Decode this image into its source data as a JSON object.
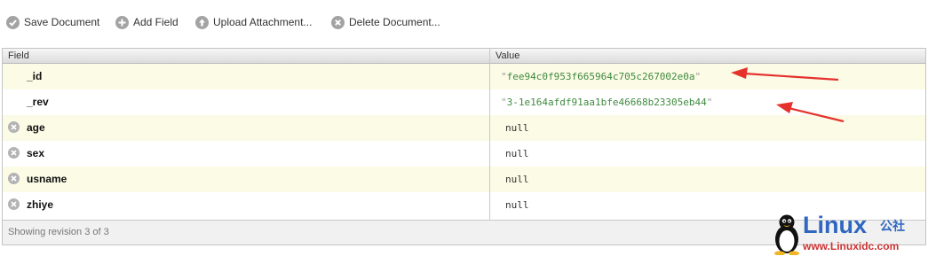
{
  "toolbar": {
    "save_label": "Save Document",
    "add_field_label": "Add Field",
    "upload_label": "Upload Attachment...",
    "delete_label": "Delete Document..."
  },
  "table": {
    "headers": {
      "field": "Field",
      "value": "Value"
    },
    "rows": [
      {
        "field": "_id",
        "value": "fee94c0f953f665964c705c267002e0a",
        "type": "string",
        "deletable": false
      },
      {
        "field": "_rev",
        "value": "3-1e164afdf91aa1bfe46668b23305eb44",
        "type": "string",
        "deletable": false
      },
      {
        "field": "age",
        "value": "null",
        "type": "null",
        "deletable": true
      },
      {
        "field": "sex",
        "value": "null",
        "type": "null",
        "deletable": true
      },
      {
        "field": "usname",
        "value": "null",
        "type": "null",
        "deletable": true
      },
      {
        "field": "zhiye",
        "value": "null",
        "type": "null",
        "deletable": true
      }
    ],
    "footer": "Showing revision 3 of 3"
  },
  "watermark": {
    "brand": "Linux",
    "brand_cn": "公社",
    "url": "www.Linuxidc.com"
  },
  "colors": {
    "string_value": "#3f8a3f",
    "annotation_arrow": "#e5322d",
    "watermark_blue": "#2f66c0",
    "watermark_red": "#cc3333"
  }
}
